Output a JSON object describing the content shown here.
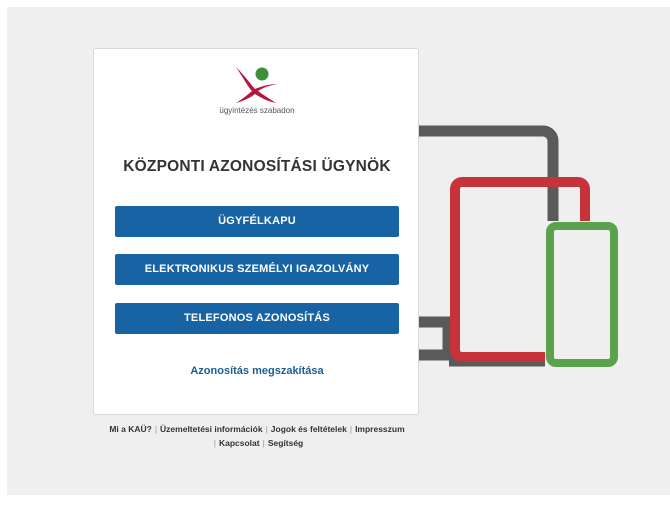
{
  "logo": {
    "tagline": "ügyintézés szabadon",
    "colors": {
      "green": "#3f8f3a",
      "red": "#b5163d"
    }
  },
  "main": {
    "title": "KÖZPONTI AZONOSÍTÁSI ÜGYNÖK",
    "buttons": [
      {
        "label": "ÜGYFÉLKAPU"
      },
      {
        "label": "ELEKTRONIKUS SZEMÉLYI IGAZOLVÁNY"
      },
      {
        "label": "TELEFONOS AZONOSÍTÁS"
      }
    ],
    "abort_link": "Azonosítás megszakítása"
  },
  "footer": {
    "links": [
      {
        "label": "Mi a KAÜ?"
      },
      {
        "label": "Üzemeltetési információk"
      },
      {
        "label": "Jogok és feltételek"
      },
      {
        "label": "Impresszum"
      },
      {
        "label": "Kapcsolat"
      },
      {
        "label": "Segítség"
      }
    ],
    "separator": "|"
  },
  "colors": {
    "button": "#1763a3",
    "laptop": "#5a5a5a",
    "tablet": "#c8323a",
    "phone": "#5aa24c",
    "background": "#efefef"
  }
}
